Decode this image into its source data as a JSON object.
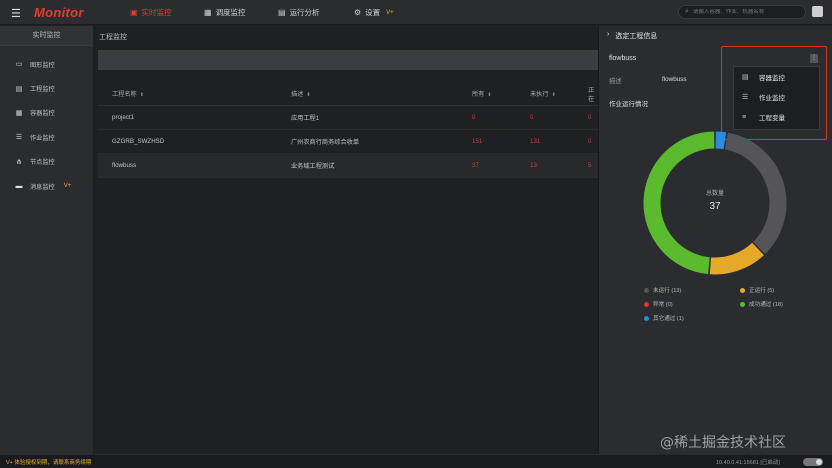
{
  "app": {
    "title": "Monitor"
  },
  "nav": [
    {
      "label": "实时监控",
      "icon": "monitor-icon",
      "active": true
    },
    {
      "label": "调度监控",
      "icon": "schedule-icon",
      "active": false
    },
    {
      "label": "运行分析",
      "icon": "analysis-icon",
      "active": false
    },
    {
      "label": "设置",
      "icon": "gear-icon",
      "active": false,
      "badge": "V+"
    }
  ],
  "search": {
    "placeholder": "请输入容器、作业、机器名称"
  },
  "sidebar": {
    "title": "实时监控",
    "items": [
      {
        "label": "图形监控",
        "icon": "chart-icon"
      },
      {
        "label": "工程监控",
        "icon": "project-icon"
      },
      {
        "label": "容器监控",
        "icon": "container-icon"
      },
      {
        "label": "作业监控",
        "icon": "job-icon"
      },
      {
        "label": "节点监控",
        "icon": "node-icon"
      },
      {
        "label": "消息监控",
        "icon": "message-icon",
        "badge": "V+"
      }
    ]
  },
  "main": {
    "breadcrumb": "工程监控",
    "columns": [
      "工程名称",
      "描述",
      "所有",
      "未执行",
      "正在"
    ],
    "rows": [
      {
        "name": "project1",
        "desc": "应用工程1",
        "all": "0",
        "pending": "0",
        "running": "0"
      },
      {
        "name": "GZGRB_SWZHSD",
        "desc": "广州农商行商务综合收单",
        "all": "151",
        "pending": "131",
        "running": "0"
      },
      {
        "name": "flowbuss",
        "desc": "业务域工程测试",
        "all": "37",
        "pending": "13",
        "running": "5"
      }
    ]
  },
  "panel": {
    "title": "选定工程信息",
    "name": "flowbuss",
    "desc_label": "描述",
    "desc_value": "flowbuss",
    "section": "作业运行情况",
    "total_label": "总数量",
    "total": "37",
    "menu": [
      {
        "label": "容器监控",
        "icon": "container-icon"
      },
      {
        "label": "作业监控",
        "icon": "job-icon"
      },
      {
        "label": "工程变量",
        "icon": "variable-icon"
      }
    ]
  },
  "chart_data": {
    "type": "pie",
    "title": "作业运行情况",
    "center_label": "总数量",
    "total": 37,
    "series": [
      {
        "name": "未运行 (13)",
        "value": 13,
        "color": "#555559"
      },
      {
        "name": "正运行 (5)",
        "value": 5,
        "color": "#e6a92a"
      },
      {
        "name": "异常 (0)",
        "value": 0,
        "color": "#d8382c"
      },
      {
        "name": "成功通过 (18)",
        "value": 18,
        "color": "#5cba2e"
      },
      {
        "name": "其它通过 (1)",
        "value": 1,
        "color": "#2b8be0"
      }
    ]
  },
  "status": {
    "left": "V+ 体验授权到期，请联系商务续期",
    "right": "10.40.0.41:15681 [已启动]"
  },
  "watermark": "@稀土掘金技术社区"
}
